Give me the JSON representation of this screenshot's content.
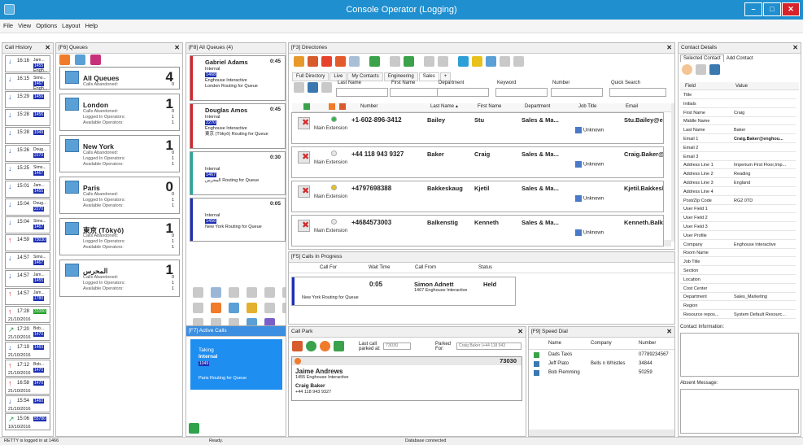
{
  "app": {
    "title": "Console Operator (Logging)"
  },
  "menu": [
    "File",
    "View",
    "Options",
    "Layout",
    "Help"
  ],
  "call_history": {
    "title": "Call History",
    "items": [
      {
        "time": "16:16",
        "dir": "in",
        "name": "Jam...",
        "ext": "1455",
        "extra": "Engh..."
      },
      {
        "time": "16:15",
        "dir": "in",
        "name": "Simo...",
        "ext": "1467",
        "extra": "Engh..."
      },
      {
        "time": "15:29",
        "dir": "in",
        "name": "",
        "ext": "1456",
        "extra": ""
      },
      {
        "time": "15:28",
        "dir": "in",
        "name": "",
        "ext": "1456",
        "extra": ""
      },
      {
        "time": "15:28",
        "dir": "in",
        "name": "",
        "ext": "1049",
        "extra": ""
      },
      {
        "time": "15:26",
        "dir": "in",
        "name": "Doug...",
        "ext": "2270",
        "extra": ""
      },
      {
        "time": "15:25",
        "dir": "in",
        "name": "Simo...",
        "ext": "1467",
        "extra": ""
      },
      {
        "time": "15:01",
        "dir": "in",
        "name": "Jam...",
        "ext": "1455",
        "extra": ""
      },
      {
        "time": "15:04",
        "dir": "in",
        "name": "Doug...",
        "ext": "2270",
        "extra": ""
      },
      {
        "time": "15:04",
        "dir": "in",
        "name": "Simo...",
        "ext": "1467",
        "extra": ""
      },
      {
        "time": "14:59",
        "dir": "out",
        "name": "",
        "ext": "73030",
        "extra": ""
      },
      {
        "time": "14:57",
        "dir": "in",
        "name": "Simo...",
        "ext": "1467",
        "extra": ""
      },
      {
        "time": "14:57",
        "dir": "in",
        "name": "Jam...",
        "ext": "1455",
        "extra": ""
      },
      {
        "time": "14:57",
        "dir": "out",
        "name": "Jam...",
        "ext": "1780",
        "extra": ""
      },
      {
        "time": "17:28",
        "dir": "out",
        "name": "",
        "ext": "31000",
        "extra": "21/10/2016"
      },
      {
        "time": "17:20",
        "dir": "miss",
        "name": "Bob...",
        "ext": "1470",
        "extra": "21/10/2016"
      },
      {
        "time": "17:19",
        "dir": "in",
        "name": "",
        "ext": "1460",
        "extra": "21/10/2016"
      },
      {
        "time": "17:12",
        "dir": "out",
        "name": "Bob...",
        "ext": "1470",
        "extra": "21/10/2016"
      },
      {
        "time": "16:58",
        "dir": "out",
        "name": "",
        "ext": "1470",
        "extra": "21/10/2016"
      },
      {
        "time": "15:54",
        "dir": "in",
        "name": "",
        "ext": "1460",
        "extra": "21/10/2016"
      },
      {
        "time": "15:06",
        "dir": "miss",
        "name": "",
        "ext": "55786",
        "extra": "10/10/2016"
      }
    ]
  },
  "queues": {
    "title": "[F6] Queues",
    "items": [
      {
        "name": "All Queues",
        "count": "4",
        "lines": [
          [
            "Calls Abandoned:",
            "0"
          ]
        ]
      },
      {
        "name": "London",
        "count": "1",
        "lines": [
          [
            "Calls Abandoned:",
            "0"
          ],
          [
            "Logged In Operators:",
            "1"
          ],
          [
            "Available Operators:",
            "1"
          ]
        ]
      },
      {
        "name": "New York",
        "count": "1",
        "lines": [
          [
            "Calls Abandoned:",
            "0"
          ],
          [
            "Logged In Operators:",
            "1"
          ],
          [
            "Available Operators:",
            "1"
          ]
        ]
      },
      {
        "name": "Paris",
        "count": "0",
        "lines": [
          [
            "Calls Abandoned:",
            "0"
          ],
          [
            "Logged In Operators:",
            "1"
          ],
          [
            "Available Operators:",
            "1"
          ]
        ]
      },
      {
        "name": "東京 (Tōkyō)",
        "count": "1",
        "lines": [
          [
            "Calls Abandoned:",
            "0"
          ],
          [
            "Logged In Operators:",
            "1"
          ],
          [
            "Available Operators:",
            "1"
          ]
        ]
      },
      {
        "name": "المحرس",
        "count": "1",
        "lines": [
          [
            "Calls Abandoned:",
            "0"
          ],
          [
            "Logged In Operators:",
            "1"
          ],
          [
            "Available Operators:",
            "1"
          ]
        ]
      }
    ]
  },
  "all_queues": {
    "title": "[F8] All Queues (4)",
    "items": [
      {
        "name": "Gabriel Adams",
        "time": "0:45",
        "lines": [
          "Internal",
          "1468",
          "Enghouse Interactive",
          "London Routing for Queue"
        ],
        "color": "#d9232a"
      },
      {
        "name": "Douglas Amos",
        "time": "0:45",
        "lines": [
          "Internal",
          "2270",
          "Enghouse Interactive",
          "東京 (Tōkyō) Routing for Queue"
        ],
        "color": "#d9232a"
      },
      {
        "name": "",
        "time": "0:30",
        "lines": [
          "Internal",
          "1467",
          "المحرس Routing for Queue"
        ],
        "color": "#22a99a"
      },
      {
        "name": "",
        "time": "0:05",
        "lines": [
          "Internal",
          "1456",
          "New York Routing for Queue"
        ],
        "color": "#1d2fb3"
      }
    ]
  },
  "active_calls": {
    "title": "[F7] Active Calls",
    "card": {
      "status": "Taking",
      "type": "Internal",
      "ext": "1049",
      "queue": "Paris Routing for Queue"
    }
  },
  "directories": {
    "title": "[F3] Directories",
    "tabs": [
      "Full Directory",
      "Live",
      "My Contacts",
      "Engineering",
      "Sales",
      "+"
    ],
    "filters": [
      "Last Name",
      "First Name",
      "Department",
      "Keyword",
      "Number",
      "Quick Search"
    ],
    "columns": [
      "Number",
      "Last Name",
      "First Name",
      "Department",
      "Job Title",
      "Email"
    ],
    "rows": [
      {
        "number": "+1-602-896-3412",
        "last": "Bailey",
        "first": "Stu",
        "dept": "Sales & Ma...",
        "job": "Unknown",
        "email": "Stu.Bailey@en",
        "dot": "#2fb84b"
      },
      {
        "number": "+44 118 943 9327",
        "last": "Baker",
        "first": "Craig",
        "dept": "Sales & Ma...",
        "job": "Unknown",
        "email": "Craig.Baker@c",
        "dot": "#e9e9e9"
      },
      {
        "number": "+4797698388",
        "last": "Bakkeskaug",
        "first": "Kjetil",
        "dept": "Sales & Ma...",
        "job": "Unknown",
        "email": "Kjetil.Bakkesk",
        "dot": "#e8c21b"
      },
      {
        "number": "+4684573003",
        "last": "Balkenstig",
        "first": "Kenneth",
        "dept": "Sales & Ma...",
        "job": "Unknown",
        "email": "Kenneth.Balke",
        "dot": "#e9e9e9"
      }
    ],
    "ext_label": "Main Extension"
  },
  "calls_in_progress": {
    "title": "[F5] Calls In Progress",
    "columns": [
      "Call For",
      "Wait Time",
      "Call From",
      "Status"
    ],
    "row": {
      "wait": "0:05",
      "from": "Simon Adnett",
      "from_sub": "1467 Enghouse Interactive",
      "status": "Held",
      "for": "New York Routing for Queue"
    }
  },
  "call_park": {
    "title": "Call Park",
    "last_call_label": "Last call parked at:",
    "last_call_value": "73030",
    "parked_for_label": "Parked For:",
    "parked_for_value": "Craig Baker (+44 118 943",
    "slot": "73030",
    "name": "Jaime Andrews",
    "sub": "1455 Enghouse Interactive",
    "for_name": "Craig Baker",
    "for_num": "+44 118 943 9327"
  },
  "speed_dial": {
    "title": "[F9] Speed Dial",
    "columns": [
      "Name",
      "Company",
      "Number"
    ],
    "rows": [
      {
        "name": "Dads Taxis",
        "company": "",
        "number": "07789234567"
      },
      {
        "name": "Jeff Plato",
        "company": "Bells n Whistles",
        "number": "34844"
      },
      {
        "name": "Bob Flemming",
        "company": "",
        "number": "50259"
      }
    ]
  },
  "contact_details": {
    "title": "Contact Details",
    "tabs": [
      "Selected Contact",
      "Add Contact"
    ],
    "columns": [
      "Field",
      "Value"
    ],
    "rows": [
      [
        "Title",
        ""
      ],
      [
        "Initials",
        ""
      ],
      [
        "First Name",
        "Craig"
      ],
      [
        "Middle Name",
        ""
      ],
      [
        "Last Name",
        "Baker"
      ],
      [
        "Email 1",
        "Craig.Baker@enghou..."
      ],
      [
        "Email 2",
        ""
      ],
      [
        "Email 3",
        ""
      ],
      [
        "Address Line 1",
        "Imperium First Floor,Imp..."
      ],
      [
        "Address Line 2",
        "Reading"
      ],
      [
        "Address Line 3",
        "England"
      ],
      [
        "Address Line 4",
        ""
      ],
      [
        "Post/Zip Code",
        "RG2 0TD"
      ],
      [
        "User Field 1",
        ""
      ],
      [
        "User Field 2",
        ""
      ],
      [
        "User Field 3",
        ""
      ],
      [
        "User Profile",
        ""
      ],
      [
        "Company",
        "Enghouse Interactive"
      ],
      [
        "Room Name",
        ""
      ],
      [
        "Job Title",
        ""
      ],
      [
        "Section",
        ""
      ],
      [
        "Location",
        ""
      ],
      [
        "Cost Center",
        ""
      ],
      [
        "Department",
        "Sales_Marketing"
      ],
      [
        "Region",
        ""
      ],
      [
        "Resource repos...",
        "System Default Resourc..."
      ]
    ],
    "info_label": "Contact Information:",
    "absent_label": "Absent Message:"
  },
  "status": {
    "left": "RETTY is logged in at 1466",
    "middle": "Ready.",
    "right": "Database connected"
  }
}
